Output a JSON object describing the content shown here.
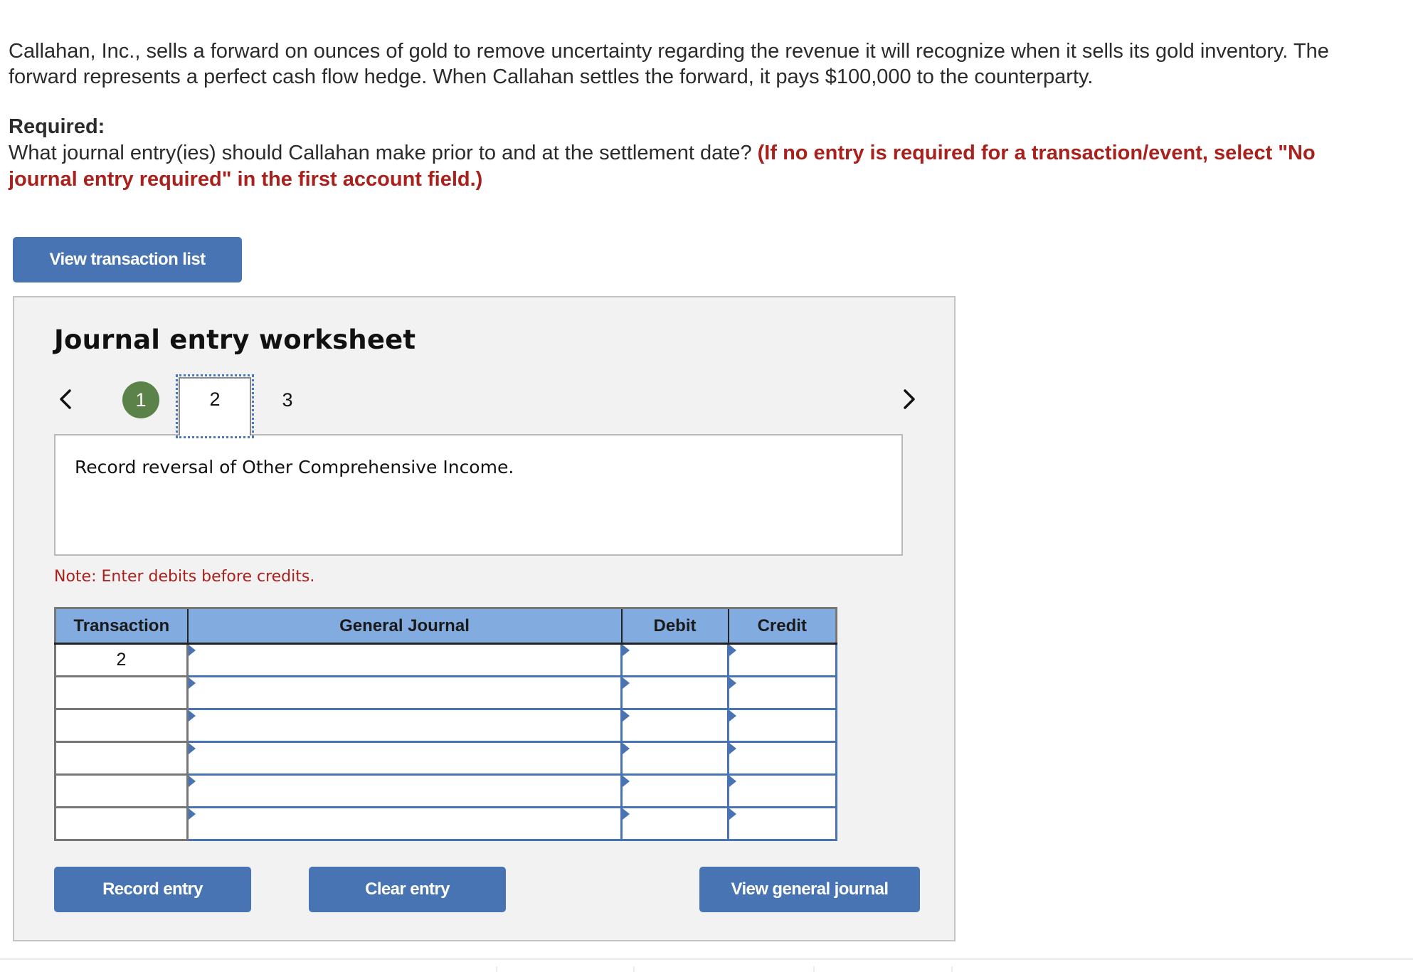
{
  "question": {
    "paragraph": "Callahan, Inc., sells a forward on ounces of gold to remove uncertainty regarding the revenue it will recognize when it sells its gold inventory. The forward represents a perfect cash flow hedge. When Callahan settles the forward, it pays $100,000 to the counterparty.",
    "required_label": "Required:",
    "required_text": "What journal entry(ies) should Callahan make prior to and at the settlement date?",
    "instruction": "(If no entry is required for a transaction/event, select \"No journal entry required\" in the first account field.)"
  },
  "buttons": {
    "view_transaction_list": "View transaction list",
    "record_entry": "Record entry",
    "clear_entry": "Clear entry",
    "view_general_journal": "View general journal"
  },
  "worksheet": {
    "title": "Journal entry worksheet",
    "steps": [
      {
        "label": "1",
        "state": "completed"
      },
      {
        "label": "2",
        "state": "current"
      },
      {
        "label": "3",
        "state": "pending"
      }
    ],
    "description": "Record reversal of Other Comprehensive Income.",
    "note": "Note: Enter debits before credits."
  },
  "table": {
    "headers": [
      "Transaction",
      "General Journal",
      "Debit",
      "Credit"
    ],
    "rows": [
      {
        "transaction": "2",
        "account": "",
        "debit": "",
        "credit": ""
      },
      {
        "transaction": "",
        "account": "",
        "debit": "",
        "credit": ""
      },
      {
        "transaction": "",
        "account": "",
        "debit": "",
        "credit": ""
      },
      {
        "transaction": "",
        "account": "",
        "debit": "",
        "credit": ""
      },
      {
        "transaction": "",
        "account": "",
        "debit": "",
        "credit": ""
      },
      {
        "transaction": "",
        "account": "",
        "debit": "",
        "credit": ""
      }
    ]
  },
  "colors": {
    "button_blue": "#4874b4",
    "header_blue": "#82acdf",
    "completed_green": "#5a8249",
    "instruction_red": "#a8211d",
    "panel_gray": "#f2f2f2"
  },
  "icons": {
    "prev": "chevron-left-icon",
    "next": "chevron-right-icon",
    "cell_marker": "dropdown-flag-icon"
  }
}
